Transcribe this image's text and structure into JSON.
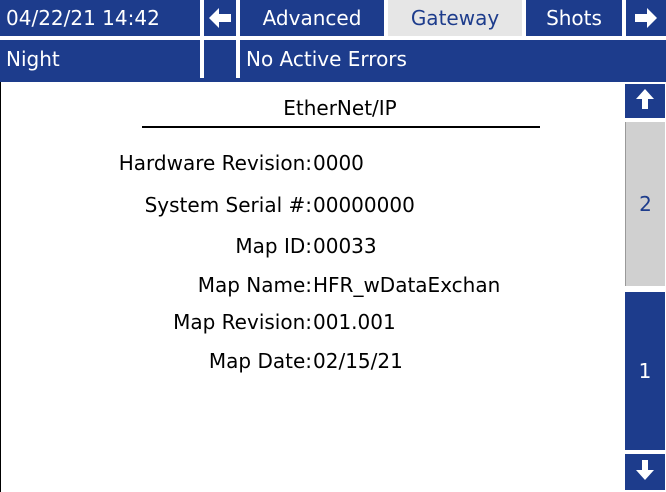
{
  "header": {
    "datetime": "04/22/21 14:42",
    "prev_icon": "left-arrow-icon",
    "tabs": [
      {
        "label": "Advanced",
        "active": false
      },
      {
        "label": "Gateway",
        "active": true
      },
      {
        "label": "Shots",
        "active": false
      }
    ],
    "next_icon": "right-arrow-icon",
    "mode": "Night",
    "status": "No Active Errors"
  },
  "panel": {
    "title": "EtherNet/IP",
    "fields": [
      {
        "label": "Hardware Revision:",
        "value": "0000"
      },
      {
        "label": "System Serial #:",
        "value": "00000000"
      },
      {
        "label": "Map ID:",
        "value": "00033"
      },
      {
        "label": "Map Name:",
        "value": "HFR_wDataExchan"
      },
      {
        "label": "Map  Revision:",
        "value": "001.001"
      },
      {
        "label": "Map Date:",
        "value": "02/15/21"
      }
    ]
  },
  "pager": {
    "up_icon": "up-arrow-icon",
    "down_icon": "down-arrow-icon",
    "page_2": "2",
    "page_1": "1"
  },
  "colors": {
    "accent": "#1d3c8c",
    "active_tab": "#e6e6e6"
  }
}
